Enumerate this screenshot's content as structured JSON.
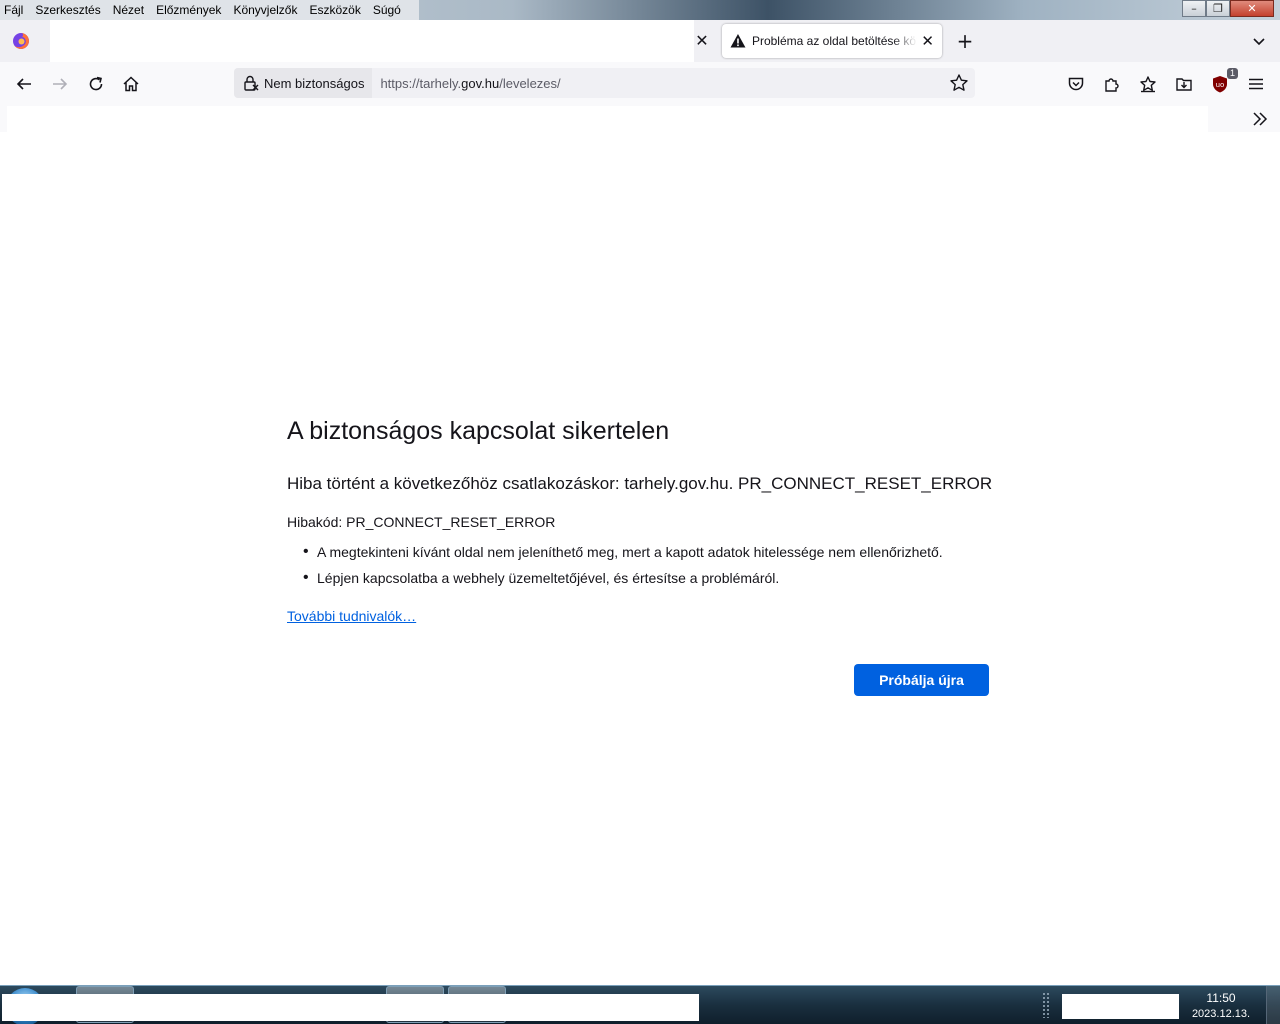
{
  "menu": [
    "Fájl",
    "Szerkesztés",
    "Nézet",
    "Előzmények",
    "Könyvjelzők",
    "Eszközök",
    "Súgó"
  ],
  "window_controls": {
    "minimize": "–",
    "restore": "❐",
    "close": "✕"
  },
  "tabs": {
    "active_title": "Probléma az oldal betöltése közben",
    "close_glyph": "✕",
    "new_tab_glyph": "+"
  },
  "navbar": {
    "security_label": "Nem biztonságos",
    "url_prefix": "https://tarhely.",
    "url_domain": "gov.hu",
    "url_suffix": "/levelezes/",
    "extension_badge": "1"
  },
  "error": {
    "title": "A biztonságos kapcsolat sikertelen",
    "description": "Hiba történt a következőhöz csatlakozáskor: tarhely.gov.hu. PR_CONNECT_RESET_ERROR",
    "code_line": "Hibakód: PR_CONNECT_RESET_ERROR",
    "bullets": [
      "A megtekinteni kívánt oldal nem jeleníthető meg, mert a kapott adatok hitelessége nem ellenőrizhető.",
      "Lépjen kapcsolatba a webhely üzemeltetőjével, és értesítse a problémáról."
    ],
    "learn_more": "További tudnivalók…",
    "retry_button": "Próbálja újra"
  },
  "taskbar": {
    "time": "11:50",
    "date": "2023.12.13."
  },
  "colors": {
    "accent": "#0061e0",
    "toolbar": "#f9f9fb",
    "tabstrip": "#f0f0f4",
    "text": "#15141a"
  }
}
